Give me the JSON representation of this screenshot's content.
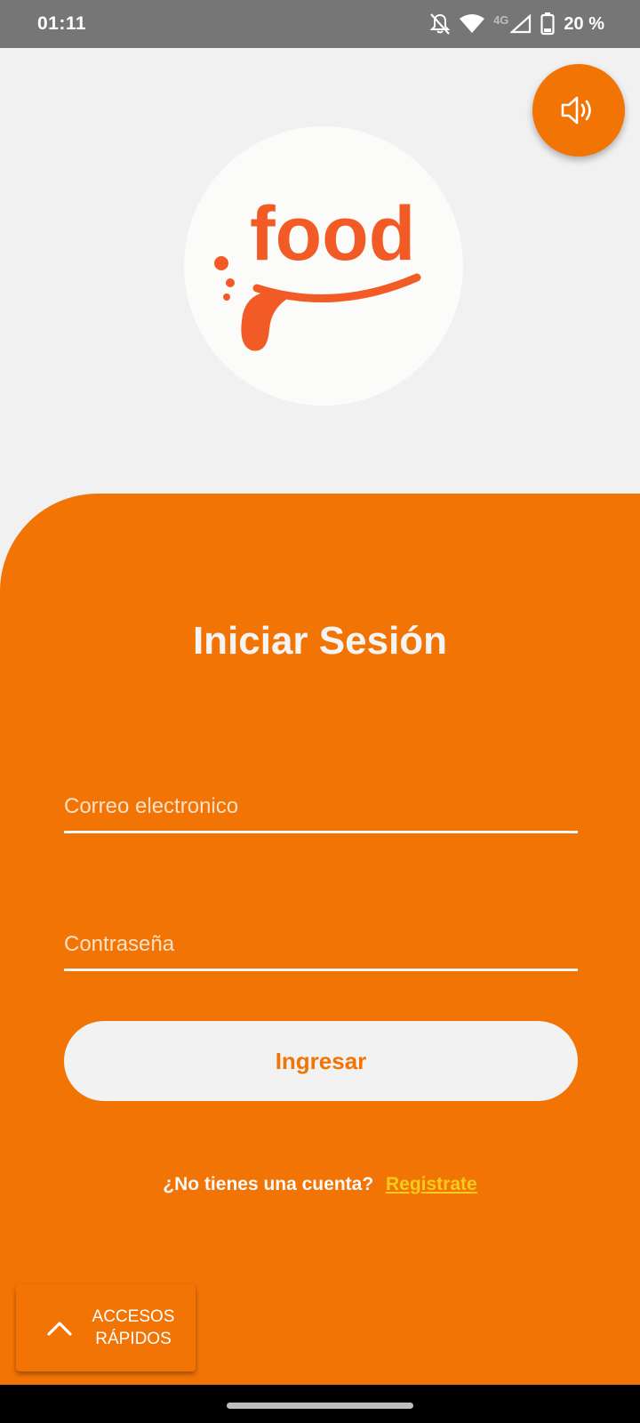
{
  "status_bar": {
    "time": "01:11",
    "network_type": "4G",
    "battery": "20 %",
    "icons": [
      "notifications-off-icon",
      "wifi-icon",
      "signal-icon",
      "battery-icon"
    ]
  },
  "sound_button": {
    "icon": "volume-icon"
  },
  "logo": {
    "text": "food"
  },
  "login": {
    "title": "Iniciar Sesión",
    "email_placeholder": "Correo electronico",
    "password_placeholder": "Contraseña",
    "submit_label": "Ingresar",
    "signup_question": "¿No tienes una cuenta?",
    "signup_link": "Registrate"
  },
  "quick_access": {
    "line1": "ACCESOS",
    "line2": "RÁPIDOS",
    "icon": "chevron-up-icon"
  },
  "colors": {
    "primary": "#f27405",
    "background": "#f1f1f1",
    "link": "#f5cc1a",
    "logo_accent": "#f25b26"
  }
}
